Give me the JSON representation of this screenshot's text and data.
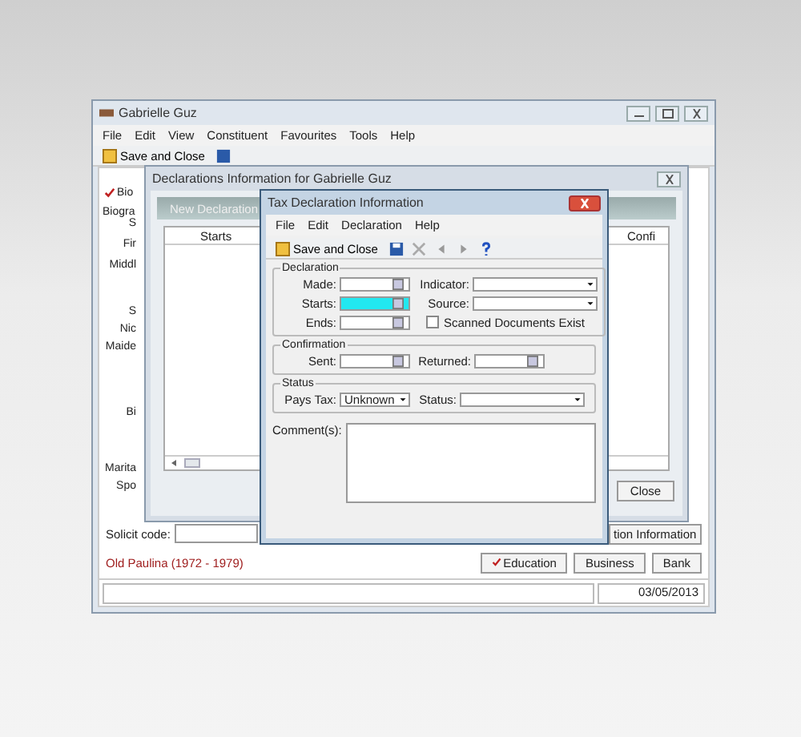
{
  "main_window": {
    "title": "Gabrielle Guz",
    "menu": [
      "File",
      "Edit",
      "View",
      "Constituent",
      "Favourites",
      "Tools",
      "Help"
    ],
    "save_label": "Save and Close",
    "tab": {
      "label": "Bio",
      "checked": true
    },
    "group_title": "Biogra",
    "field_labels": [
      "S",
      "Fir",
      "Middl",
      "S",
      "Nic",
      "Maide",
      "Bi",
      "Marita",
      "Spo"
    ],
    "solicit_label": "Solicit code:",
    "info_button": "tion Information",
    "former_name": "Old Paulina (1972 - 1979)",
    "buttons": [
      {
        "label": "Education",
        "checked": true
      },
      {
        "label": "Business",
        "checked": false
      },
      {
        "label": "Bank",
        "checked": false
      }
    ],
    "status_date": "03/05/2013"
  },
  "declarations_window": {
    "title": "Declarations Information for Gabrielle Guz",
    "toolbar_label": "New Declaration",
    "columns": [
      "Starts",
      "Confi"
    ],
    "close_button": "Close"
  },
  "tax_window": {
    "title": "Tax Declaration Information",
    "menu": [
      "File",
      "Edit",
      "Declaration",
      "Help"
    ],
    "save_label": "Save and Close",
    "declaration": {
      "title": "Declaration",
      "left": [
        {
          "label": "Made:",
          "kind": "date",
          "focused": false
        },
        {
          "label": "Starts:",
          "kind": "date",
          "focused": true
        },
        {
          "label": "Ends:",
          "kind": "date",
          "focused": false
        }
      ],
      "right": [
        {
          "label": "Indicator:",
          "kind": "combo",
          "focused": false
        },
        {
          "label": "Source:",
          "kind": "combo",
          "focused": false
        }
      ],
      "checkbox": {
        "label": "Scanned Documents Exist",
        "checked": false
      }
    },
    "confirmation": {
      "title": "Confirmation",
      "fields": [
        {
          "label": "Sent:",
          "kind": "date",
          "focused": false
        },
        {
          "label": "Returned:",
          "kind": "date",
          "focused": false
        }
      ]
    },
    "status": {
      "title": "Status",
      "fields": [
        {
          "label": "Pays Tax:",
          "kind": "combo",
          "value": "Unknown",
          "focused": false
        },
        {
          "label": "Status:",
          "kind": "combo",
          "focused": false
        }
      ]
    },
    "comments_label": "Comment(s):"
  }
}
